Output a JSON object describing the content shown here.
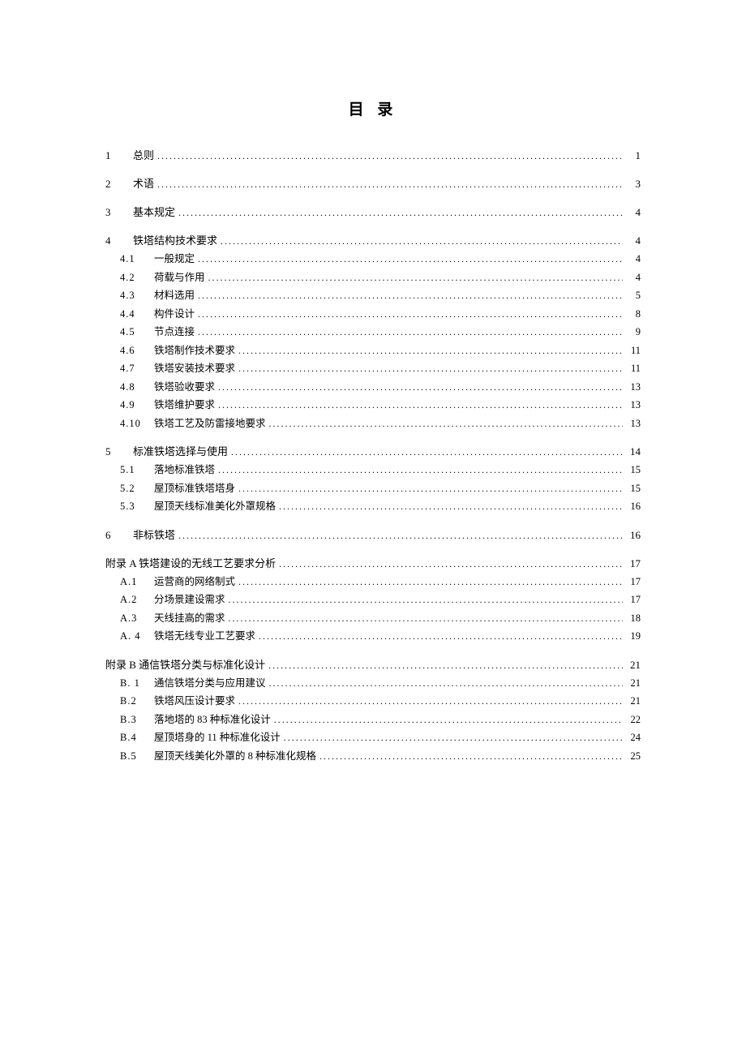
{
  "title": "目 录",
  "entries": [
    {
      "level": 1,
      "num": "1",
      "text": "总则",
      "page": "1"
    },
    {
      "level": 1,
      "num": "2",
      "text": "术语",
      "page": "3"
    },
    {
      "level": 1,
      "num": "3",
      "text": "基本规定",
      "page": "4"
    },
    {
      "level": 1,
      "num": "4",
      "text": "铁塔结构技术要求",
      "page": "4"
    },
    {
      "level": 2,
      "num": "4.1",
      "text": "一般规定",
      "page": "4"
    },
    {
      "level": 2,
      "num": "4.2",
      "text": "荷载与作用",
      "page": "4"
    },
    {
      "level": 2,
      "num": "4.3",
      "text": "材料选用",
      "page": "5"
    },
    {
      "level": 2,
      "num": "4.4",
      "text": "构件设计",
      "page": "8"
    },
    {
      "level": 2,
      "num": "4.5",
      "text": "节点连接",
      "page": "9"
    },
    {
      "level": 2,
      "num": "4.6",
      "text": "铁塔制作技术要求",
      "page": "11"
    },
    {
      "level": 2,
      "num": "4.7",
      "text": "铁塔安装技术要求",
      "page": "11"
    },
    {
      "level": 2,
      "num": "4.8",
      "text": "铁塔验收要求",
      "page": "13"
    },
    {
      "level": 2,
      "num": "4.9",
      "text": "铁塔维护要求",
      "page": "13"
    },
    {
      "level": 2,
      "num": "4.10",
      "text": "铁塔工艺及防雷接地要求",
      "page": "13"
    },
    {
      "level": 1,
      "num": "5",
      "text": "标准铁塔选择与使用",
      "page": "14"
    },
    {
      "level": 2,
      "num": "5.1",
      "text": "落地标准铁塔",
      "page": "15"
    },
    {
      "level": 2,
      "num": "5.2",
      "text": "屋顶标准铁塔塔身",
      "page": "15"
    },
    {
      "level": 2,
      "num": "5.3",
      "text": "屋顶天线标准美化外罩规格",
      "page": "16"
    },
    {
      "level": 1,
      "num": "6",
      "text": "非标铁塔",
      "page": "16"
    },
    {
      "level": 1,
      "num": "",
      "text": "附录 A 铁塔建设的无线工艺要求分析",
      "page": "17",
      "appendix": true
    },
    {
      "level": 2,
      "num": "A.1",
      "text": "运营商的网络制式",
      "page": "17"
    },
    {
      "level": 2,
      "num": "A.2",
      "text": "分场景建设需求",
      "page": "17"
    },
    {
      "level": 2,
      "num": "A.3",
      "text": "天线挂高的需求",
      "page": "18"
    },
    {
      "level": 2,
      "num": "A. 4",
      "text": "铁塔无线专业工艺要求",
      "page": "19"
    },
    {
      "level": 1,
      "num": "",
      "text": "附录 B 通信铁塔分类与标准化设计",
      "page": "21",
      "appendix": true
    },
    {
      "level": 2,
      "num": "B. 1",
      "text": "通信铁塔分类与应用建议",
      "page": "21"
    },
    {
      "level": 2,
      "num": "B.2",
      "text": "铁塔风压设计要求",
      "page": "21"
    },
    {
      "level": 2,
      "num": "B.3",
      "text": "落地塔的 83 种标准化设计",
      "page": "22"
    },
    {
      "level": 2,
      "num": "B.4",
      "text": "屋顶塔身的 11 种标准化设计",
      "page": "24"
    },
    {
      "level": 2,
      "num": "B.5",
      "text": "屋顶天线美化外罩的 8 种标准化规格",
      "page": "25"
    }
  ]
}
